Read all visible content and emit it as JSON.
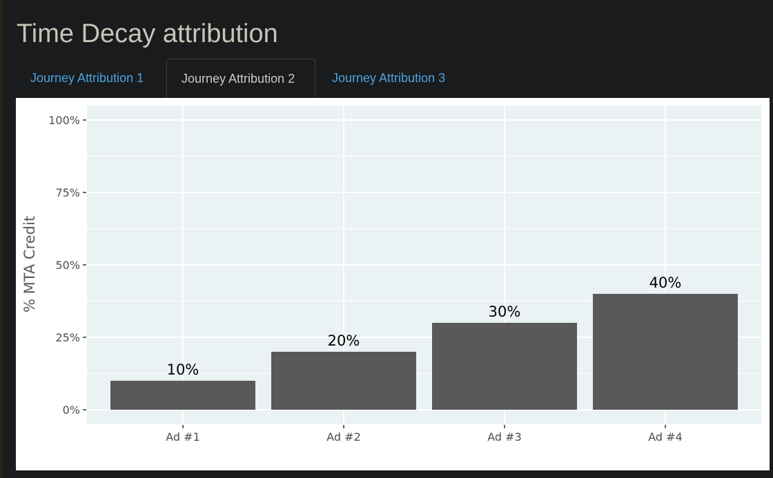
{
  "page": {
    "title": "Time Decay attribution"
  },
  "tabs": [
    {
      "label": "Journey Attribution 1",
      "active": false
    },
    {
      "label": "Journey Attribution 2",
      "active": true
    },
    {
      "label": "Journey Attribution 3",
      "active": false
    }
  ],
  "colors": {
    "background": "#1a1b1d",
    "title": "#c8c3b8",
    "tab_link": "#4aa3df",
    "tab_active_text": "#c9c9c9",
    "plot_background": "#eaf2f4",
    "bar": "#595959"
  },
  "chart_data": {
    "type": "bar",
    "categories": [
      "Ad #1",
      "Ad #2",
      "Ad #3",
      "Ad #4"
    ],
    "values": [
      10,
      20,
      30,
      40
    ],
    "value_labels": [
      "10%",
      "20%",
      "30%",
      "40%"
    ],
    "ylabel": "% MTA Credit",
    "ylim": [
      0,
      100
    ],
    "yticks": [
      0,
      25,
      50,
      75,
      100
    ],
    "ytick_labels": [
      "0%",
      "25%",
      "50%",
      "75%",
      "100%"
    ],
    "grid": true
  }
}
